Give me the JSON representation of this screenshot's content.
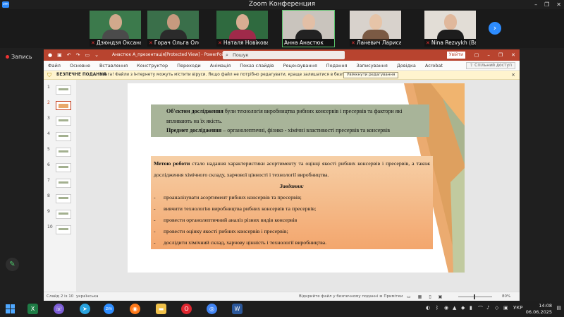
{
  "zoom": {
    "title": "Zoom Конференция",
    "logo_label": "zm",
    "window_controls": [
      "–",
      "❐",
      "✕"
    ],
    "participants": [
      {
        "name": "Дзюндзя Оксана"
      },
      {
        "name": "Горач Ольга Олексіївна"
      },
      {
        "name": "Наталя Новікова"
      },
      {
        "name": "Анна Анастюк"
      },
      {
        "name": "Ланевич Лариса"
      },
      {
        "name": "Nina Rezvykh (Babiy)"
      }
    ],
    "next_label": "›",
    "record_label": "Запись",
    "pen_label": "✎"
  },
  "ppt": {
    "doc_title": "Анастюк А_презентація[Protected View] - PowerPoint",
    "search_placeholder": "Пошук",
    "signin_label": "Увійти",
    "ribbon_tabs": [
      "Файл",
      "Основне",
      "Вставлення",
      "Конструктор",
      "Переходи",
      "Анімація",
      "Показ слайдів",
      "Рецензування",
      "Подання",
      "Записування",
      "Довідка",
      "Acrobat"
    ],
    "share_label": "Спільний доступ",
    "protected_view": {
      "title": "БЕЗПЕЧНЕ ПОДАННЯ",
      "message": "Увага! Файли з Інтернету можуть містити віруси. Якщо файл не потрібно редагувати, краще залишатися в безпечному поданні.",
      "button": "Увімкнути редагування",
      "close": "×"
    },
    "slide_numbers": [
      "1",
      "2",
      "3",
      "4",
      "5",
      "6",
      "7",
      "8",
      "9",
      "10"
    ],
    "selected_slide": 2,
    "slide": {
      "obj_label": "Об'єктом дослідження",
      "obj_text": " були технологія виробництва рибних консервів і пресервів та  фактори які впливають на їх якість.",
      "subj_label": "Предмет дослідження",
      "subj_text": " – органолептичні, фізико - хімічні властивості пресервів та консервів",
      "aim_label": "Метою роботи",
      "aim_text": " стало надання характеристики асортименту та оцінці якості рибних консервів і пресервів, а також дослідження хімічного складу, харчової цінності і технології виробництва.",
      "tasks_title": "Завдання:",
      "tasks": [
        "проаналізувати асортимент рибних консервів та пресервів;",
        " вивчити технологію виробництва рибних консервів та пресервів;",
        "провести органолептичний аналіз різних видів консервів",
        "провести оцінку якості рибних консервів і пресервів;",
        " дослідити хімічний склад, харчову цінність і технології виробництва."
      ]
    },
    "status": {
      "slide_count": "Слайд 2 із 10",
      "language": "українська",
      "safe_mode": "Відкрийте файл у безпечному поданні",
      "notes": "Примітки",
      "zoom": "80%"
    }
  },
  "taskbar": {
    "apps": [
      "Viber",
      "Telegram",
      "Zoom",
      "Firefox",
      "Explorer",
      "Opera",
      "Chrome",
      "Word"
    ],
    "language": "УКР",
    "time": "14:08",
    "date": "06.06.2025"
  }
}
